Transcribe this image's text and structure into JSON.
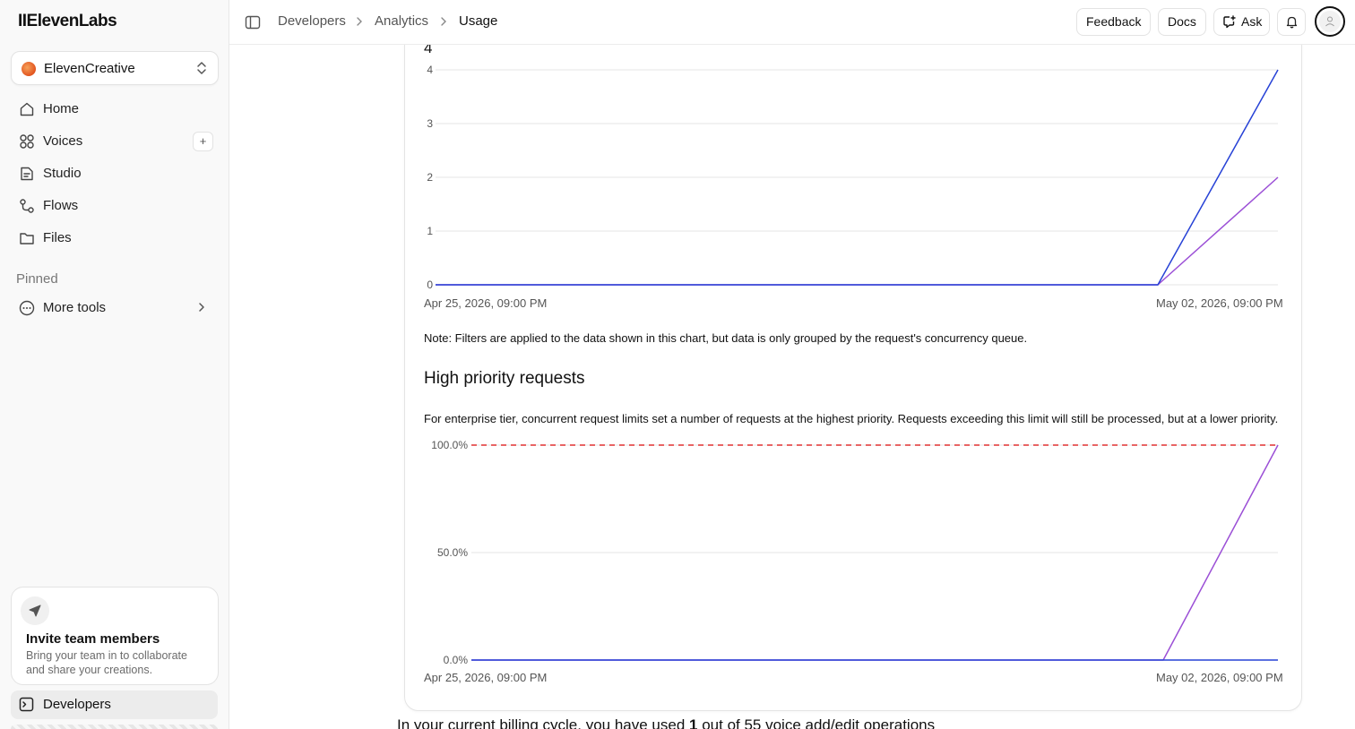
{
  "app": {
    "logo": "IIElevenLabs"
  },
  "sidebar": {
    "workspace": "ElevenCreative",
    "items": [
      {
        "label": "Home"
      },
      {
        "label": "Voices",
        "action": "+"
      },
      {
        "label": "Studio"
      },
      {
        "label": "Flows"
      },
      {
        "label": "Files"
      }
    ],
    "pinned_label": "Pinned",
    "more_tools": "More tools",
    "invite": {
      "title": "Invite team members",
      "description": "Bring your team in to collaborate and share your creations."
    },
    "active_item": "Developers"
  },
  "header": {
    "breadcrumbs": [
      "Developers",
      "Analytics",
      "Usage"
    ],
    "buttons": {
      "feedback": "Feedback",
      "docs": "Docs",
      "ask": "Ask"
    }
  },
  "main": {
    "concurrency_peak": "4",
    "note": "Note: Filters are applied to the data shown in this chart, but data is only grouped by the request's concurrency queue.",
    "high_priority_title": "High priority requests",
    "high_priority_desc": "For enterprise tier, concurrent request limits set a number of requests at the highest priority. Requests exceeding this limit will still be processed, but at a lower priority.",
    "billing_prefix": "In your current billing cycle, you have used ",
    "billing_used": "1",
    "billing_suffix": " out of 55 voice add/edit operations"
  },
  "chart_data": [
    {
      "type": "line",
      "x_labels": [
        "Apr 25, 2026, 09:00 PM",
        "May 02, 2026, 09:00 PM"
      ],
      "y_ticks": [
        "0",
        "1",
        "2",
        "3",
        "4"
      ],
      "ylim": [
        0,
        4
      ],
      "grid": true,
      "x": [
        "Apr 25, 2026, 09:00 PM",
        "May 01, 2026, 09:00 PM",
        "May 02, 2026, 09:00 PM"
      ],
      "series": [
        {
          "color": "#2742d6",
          "values": [
            0,
            0,
            4
          ]
        },
        {
          "color": "#9b4fd6",
          "values": [
            0,
            0,
            2
          ]
        }
      ]
    },
    {
      "type": "line",
      "x_labels": [
        "Apr 25, 2026, 09:00 PM",
        "May 02, 2026, 09:00 PM"
      ],
      "y_ticks": [
        "0.0%",
        "50.0%",
        "100.0%"
      ],
      "ylim": [
        0,
        100
      ],
      "grid": true,
      "threshold": {
        "value": 100,
        "color": "#e03131",
        "style": "dashed"
      },
      "x": [
        "Apr 25, 2026, 09:00 PM",
        "May 01, 2026, 09:00 PM",
        "May 02, 2026, 09:00 PM"
      ],
      "series": [
        {
          "color": "#2742d6",
          "values": [
            0,
            0,
            0
          ]
        },
        {
          "color": "#9b4fd6",
          "values": [
            0,
            0,
            100
          ]
        }
      ]
    }
  ]
}
